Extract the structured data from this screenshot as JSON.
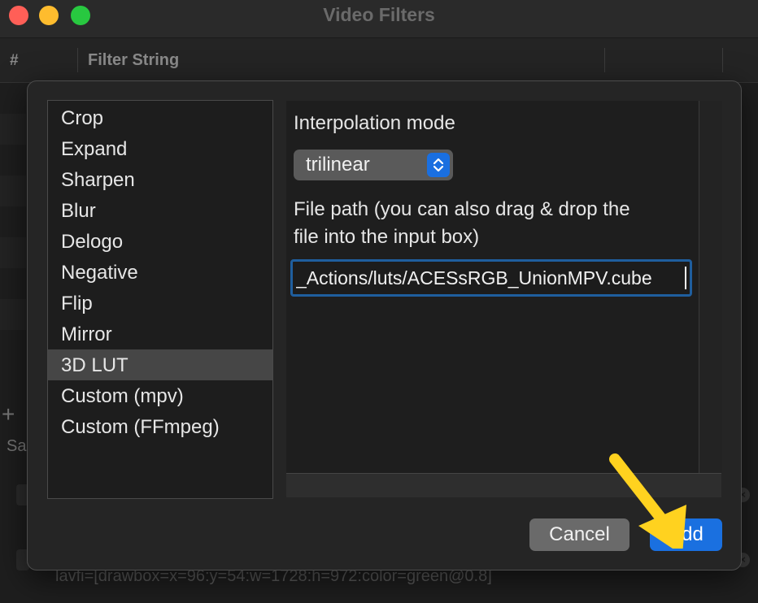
{
  "window": {
    "title": "Video Filters",
    "columns": {
      "number": "#",
      "filter_string": "Filter String"
    },
    "add_icon": "plus-icon",
    "bottom_label_partial": "Sa",
    "bottom_row_text": "lavfi=[drawbox=x=96:y=54:w=1728:h=972:color=green@0.8]"
  },
  "dialog": {
    "filters": [
      {
        "label": "Crop"
      },
      {
        "label": "Expand"
      },
      {
        "label": "Sharpen"
      },
      {
        "label": "Blur"
      },
      {
        "label": "Delogo"
      },
      {
        "label": "Negative"
      },
      {
        "label": "Flip"
      },
      {
        "label": "Mirror"
      },
      {
        "label": "3D LUT",
        "selected": true
      },
      {
        "label": "Custom (mpv)"
      },
      {
        "label": "Custom (FFmpeg)"
      }
    ],
    "options": {
      "interpolation_label": "Interpolation mode",
      "interpolation_value": "trilinear",
      "file_path_label_line1": "File path (you can also drag & drop the",
      "file_path_label_line2": "file into the input box)",
      "file_path_value": "_Actions/luts/ACESsRGB_UnionMPV.cube"
    },
    "buttons": {
      "cancel": "Cancel",
      "add": "Add"
    }
  },
  "colors": {
    "accent": "#1a70e0",
    "focus_ring": "#1f5e9e",
    "annotation_arrow": "#ffd21f"
  }
}
